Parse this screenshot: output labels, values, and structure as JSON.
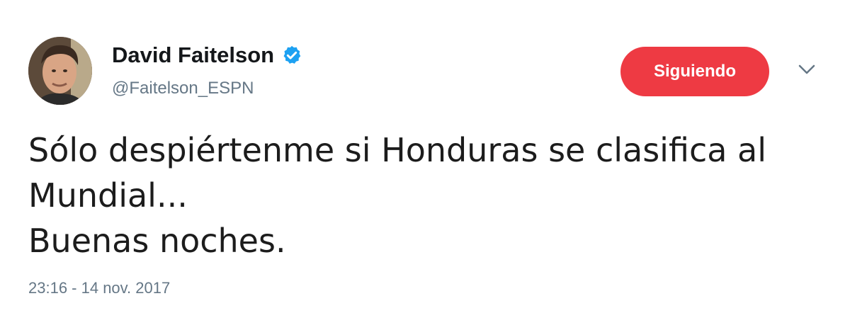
{
  "author": {
    "display_name": "David Faitelson",
    "handle": "@Faitelson_ESPN",
    "verified": true
  },
  "follow_button": {
    "label": "Siguiendo"
  },
  "tweet": {
    "lines": [
      "Sólo despiértenme si Honduras se clasifica al",
      "Mundial...",
      "Buenas noches."
    ],
    "timestamp": "23:16 - 14 nov. 2017"
  },
  "icons": {
    "verified": "verified-badge-icon",
    "menu": "chevron-down-icon"
  },
  "colors": {
    "follow_button_bg": "#ee3a43",
    "verified_badge": "#1da1f2",
    "secondary_text": "#657786"
  }
}
